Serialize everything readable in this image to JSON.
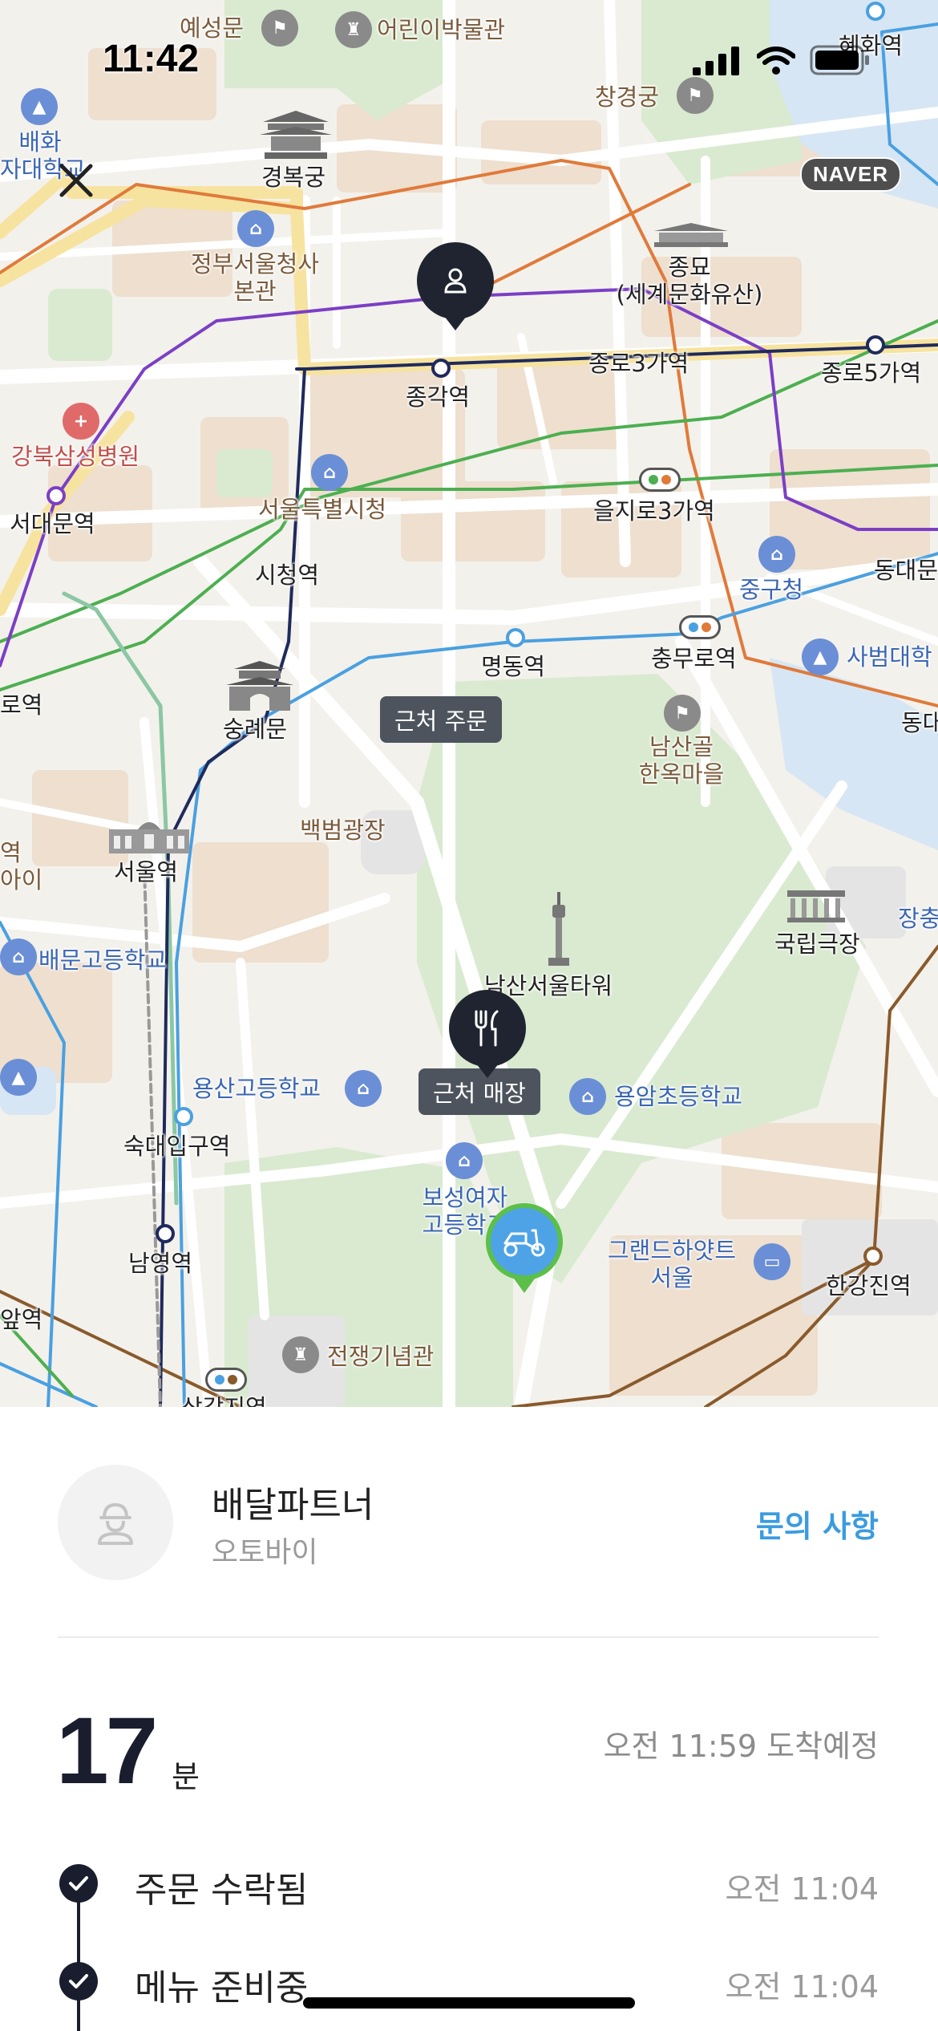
{
  "status_bar": {
    "time": "11:42"
  },
  "map": {
    "provider_badge": "NAVER",
    "labels": {
      "yeseongmun": "예성문",
      "childrens_museum": "어린이박물관",
      "hyehwa": "혜화역",
      "changgyeonggung": "창경궁",
      "baehwa": "배화\n자대학교",
      "gyeongbokgung": "경복궁",
      "gov_complex": "정부서울청사\n본관",
      "jongmyo": "종묘\n(세계문화유산)",
      "jonggak": "종각역",
      "jongno3": "종로3가역",
      "jongno5": "종로5가역",
      "kangbuk_samsung": "강북삼성병원",
      "seodaemun": "서대문역",
      "city_hall": "서울특별시청",
      "euljiro3": "을지로3가역",
      "sicheong": "시청역",
      "junggu_office": "중구청",
      "dongdaemun": "동대문",
      "chungmuro": "충무로역",
      "sabeom": "사범대학",
      "myeongdong": "명동역",
      "sungnyemun": "숭례문",
      "namsangol": "남산골\n한옥마을",
      "dongdae2": "동대",
      "left_station1": "로역",
      "department_plaza": "백범광장",
      "seoul_station": "서울역",
      "left_edge1": "역\n아이",
      "national_theater": "국립극장",
      "jangchung": "장충",
      "baemun_hs": "배문고등학교",
      "namsan_tower": "남산서울타워",
      "yongsan_hs": "용산고등학교",
      "yongam_es": "용암초등학교",
      "sookmyung": "숙대입구역",
      "boseong": "보성여자\n고등학교",
      "grand_hyatt": "그랜드하얏트\n서울",
      "namyeong": "남영역",
      "hangangjin": "한강진역",
      "left_station2": "앞역",
      "war_memorial": "전쟁기념관",
      "samgakji": "삼각지역"
    },
    "tags": {
      "nearby_order": "근처 주문",
      "nearby_store": "근처 매장"
    }
  },
  "partner": {
    "name": "배달파트너",
    "vehicle": "오토바이",
    "inquiry_label": "문의 사항"
  },
  "eta": {
    "minutes": "17",
    "unit": "분",
    "arrival_text": "오전 11:59 도착예정"
  },
  "steps": [
    {
      "label": "주문 수락됨",
      "time": "오전 11:04"
    },
    {
      "label": "메뉴 준비중",
      "time": "오전 11:04"
    }
  ],
  "colors": {
    "line_navy": "#1f2a5c",
    "line_purple": "#7b3fc4",
    "line_green": "#4caf50",
    "line_blue": "#4aa0e0",
    "line_orange": "#e07a3a",
    "line_brown": "#8a5a2b",
    "accent_blue": "#3a9be0",
    "pin_dark": "#1f2430",
    "rider_blue": "#4ea3e6",
    "rider_green": "#5bbf4a"
  }
}
